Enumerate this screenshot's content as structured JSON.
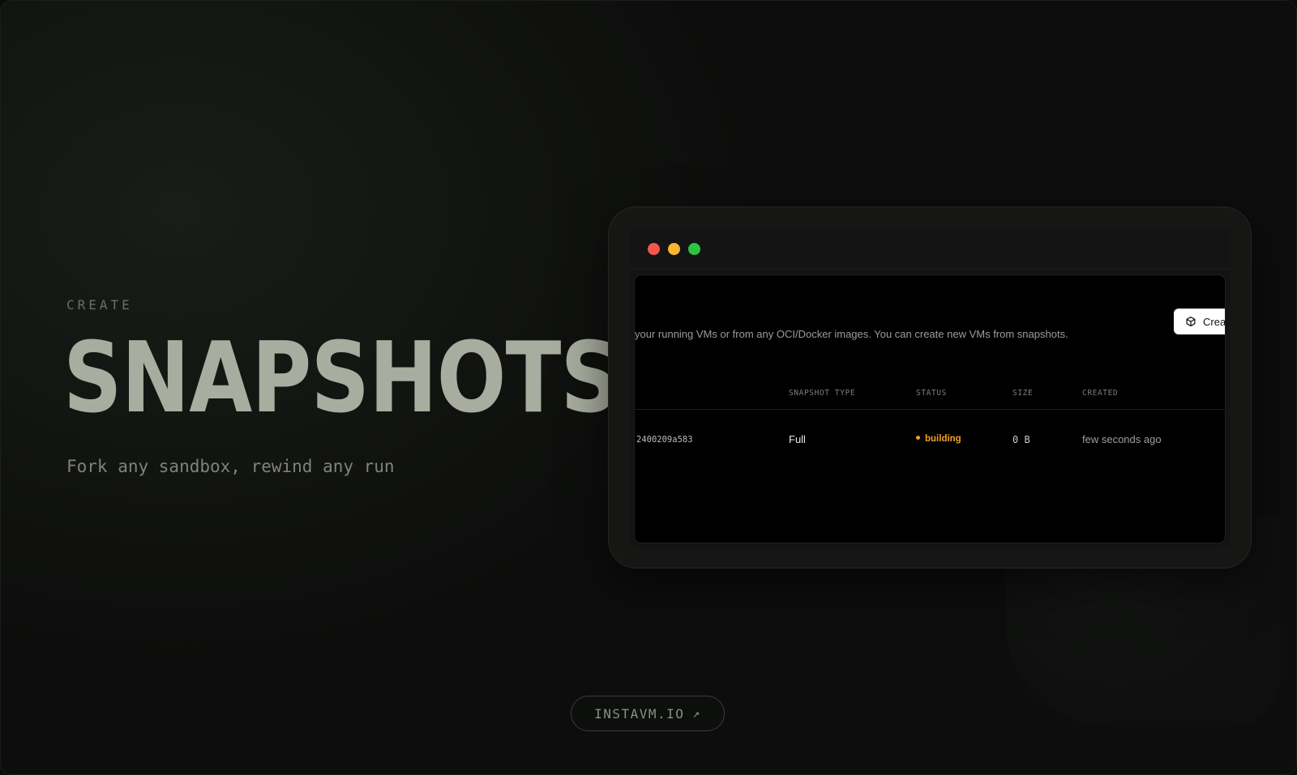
{
  "hero": {
    "eyebrow": "CREATE",
    "title": "SNAPSHOTS",
    "tagline": "Fork any sandbox, rewind any run"
  },
  "window": {
    "controls": [
      "close",
      "minimize",
      "maximize"
    ],
    "description": "your running VMs or from any OCI/Docker images. You can create new VMs from snapshots.",
    "create_button_label": "Crea",
    "create_button_icon": "cube-icon",
    "table": {
      "headers": [
        "SNAPSHOT TYPE",
        "STATUS",
        "SIZE",
        "CREATED"
      ],
      "rows": [
        {
          "id": "2400209a583",
          "type": "Full",
          "status": "building",
          "size": "0 B",
          "created": "few seconds ago"
        }
      ]
    }
  },
  "footer": {
    "link_label": "INSTAVM.IO",
    "link_icon": "arrow-up-right-icon",
    "arrow_glyph": "↗"
  },
  "colors": {
    "title": "#a8ad9f",
    "status_building": "#f0a024",
    "traffic_red": "#f2564f",
    "traffic_yellow": "#f7b62d",
    "traffic_green": "#2ec43f"
  }
}
